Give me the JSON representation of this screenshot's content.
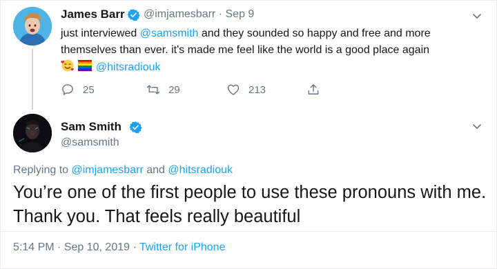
{
  "parent_tweet": {
    "author_name": "James Barr",
    "handle": "@imjamesbarr",
    "separator": "·",
    "date": "Sep 9",
    "text_part1": "just interviewed ",
    "mention1": "@samsmith",
    "text_part2": " and they sounded so happy and free and more themselves than ever. it's made me feel like the world is a good place again",
    "emojis": [
      "smiling-face-with-hearts",
      "rainbow-flag"
    ],
    "mention2": "@hitsradiouk",
    "replies": "25",
    "retweets": "29",
    "likes": "213"
  },
  "reply_tweet": {
    "author_name": "Sam Smith",
    "handle": "@samsmith",
    "replying_prefix": "Replying to",
    "replying_to1": "@imjamesbarr",
    "replying_and": "and",
    "replying_to2": "@hitsradiouk",
    "text": "You’re one of the first people to use these pronouns with me. Thank you. That feels really beautiful",
    "time": "5:14 PM",
    "separator": "·",
    "date": "Sep 10, 2019",
    "source": "Twitter for iPhone"
  },
  "colors": {
    "accent": "#1da1f2",
    "secondary_text": "#657786",
    "primary_text": "#14171a",
    "divider": "#e6ecf0"
  }
}
